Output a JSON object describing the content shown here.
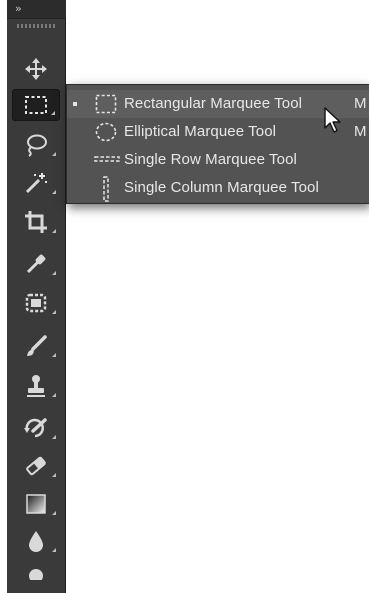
{
  "toolbar": {
    "collapse_icon_text": "››",
    "tools": [
      {
        "name": "move-tool",
        "icon": "move-icon"
      },
      {
        "name": "rectangular-marquee-tool",
        "icon": "rectangular-marquee-icon",
        "active": true
      },
      {
        "name": "lasso-tool",
        "icon": "lasso-icon"
      },
      {
        "name": "magic-wand-tool",
        "icon": "magic-wand-icon"
      },
      {
        "name": "crop-tool",
        "icon": "crop-icon"
      },
      {
        "name": "eyedropper-tool",
        "icon": "eyedropper-icon"
      },
      {
        "name": "spot-healing-tool",
        "icon": "healing-icon"
      },
      {
        "name": "brush-tool",
        "icon": "brush-icon"
      },
      {
        "name": "clone-stamp-tool",
        "icon": "stamp-icon"
      },
      {
        "name": "history-brush-tool",
        "icon": "history-brush-icon"
      },
      {
        "name": "eraser-tool",
        "icon": "eraser-icon"
      },
      {
        "name": "gradient-tool",
        "icon": "gradient-icon"
      },
      {
        "name": "blur-tool",
        "icon": "blur-drop-icon"
      }
    ]
  },
  "flyout": {
    "items": [
      {
        "label": "Rectangular Marquee Tool",
        "shortcut": "M",
        "icon": "rectangular-marquee-icon",
        "selected": true
      },
      {
        "label": "Elliptical Marquee Tool",
        "shortcut": "M",
        "icon": "elliptical-marquee-icon",
        "selected": false
      },
      {
        "label": "Single Row Marquee Tool",
        "shortcut": "",
        "icon": "single-row-marquee-icon",
        "selected": false
      },
      {
        "label": "Single Column Marquee Tool",
        "shortcut": "",
        "icon": "single-column-marquee-icon",
        "selected": false
      }
    ]
  },
  "colors": {
    "toolbar_bg": "#3a3a3a",
    "flyout_bg": "#535353",
    "highlight_bg": "#5e5e5e",
    "text": "#e8e8e8"
  }
}
